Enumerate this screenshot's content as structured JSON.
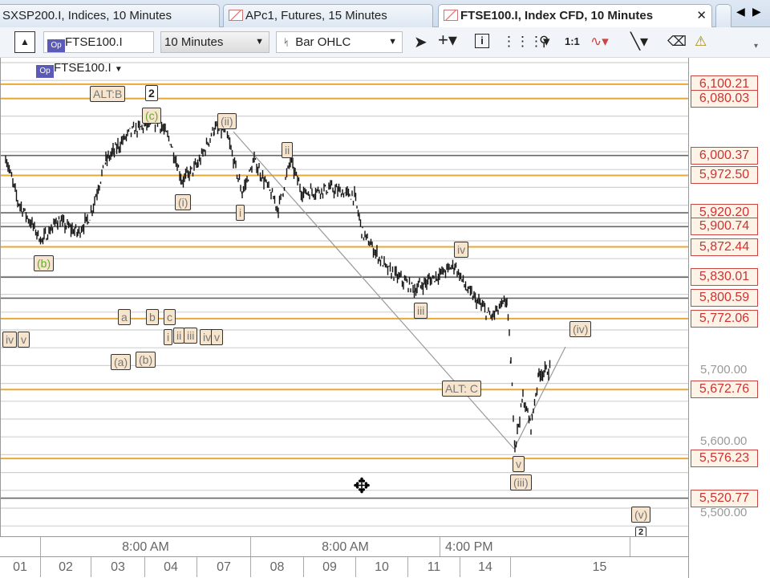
{
  "tabs": [
    {
      "label": "SXSP200.I, Indices, 10 Minutes"
    },
    {
      "label": "APc1, Futures, 15 Minutes"
    },
    {
      "label": "FTSE100.I, Index CFD, 10 Minutes",
      "active": true
    }
  ],
  "toolbar": {
    "symbol": "FTSE100.I",
    "interval": "10 Minutes",
    "chart_type": "Bar OHLC",
    "op_badge": "Op",
    "zoom_label": "1:1"
  },
  "legend": {
    "symbol": "FTSE100.I"
  },
  "colors": {
    "level_line": "#e8a838",
    "grey_line": "#666666",
    "level_box": "#cc4444"
  },
  "chart_data": {
    "type": "bar",
    "title": "FTSE100.I OHLC 10 Minutes",
    "ylim": [
      5470,
      6130
    ],
    "y_ticks": [
      "5,700.00",
      "5,600.00",
      "5,500.00"
    ],
    "price_levels": [
      "6,100.21",
      "6,080.03",
      "6,000.37",
      "5,972.50",
      "5,920.20",
      "5,900.74",
      "5,872.44",
      "5,830.01",
      "5,800.59",
      "5,772.06",
      "5,672.76",
      "5,576.23",
      "5,520.77"
    ],
    "x_sessions": [
      "8:00 AM",
      "8:00 AM",
      "4:00 PM"
    ],
    "x_days": [
      "01",
      "02",
      "03",
      "04",
      "07",
      "08",
      "09",
      "10",
      "11",
      "14",
      "15"
    ],
    "path": [
      [
        0,
        5999
      ],
      [
        15,
        5937
      ],
      [
        45,
        5881
      ],
      [
        65,
        5909
      ],
      [
        90,
        5892
      ],
      [
        105,
        5915
      ],
      [
        125,
        5993
      ],
      [
        155,
        6033
      ],
      [
        190,
        6049
      ],
      [
        205,
        6021
      ],
      [
        220,
        5965
      ],
      [
        240,
        5988
      ],
      [
        260,
        6038
      ],
      [
        275,
        6033
      ],
      [
        295,
        5948
      ],
      [
        310,
        5993
      ],
      [
        325,
        5960
      ],
      [
        340,
        5926
      ],
      [
        355,
        5993
      ],
      [
        370,
        5948
      ],
      [
        405,
        5954
      ],
      [
        435,
        5943
      ],
      [
        445,
        5892
      ],
      [
        475,
        5842
      ],
      [
        510,
        5813
      ],
      [
        535,
        5830
      ],
      [
        560,
        5847
      ],
      [
        575,
        5813
      ],
      [
        605,
        5774
      ],
      [
        625,
        5797
      ],
      [
        630,
        5707
      ],
      [
        635,
        5594
      ],
      [
        645,
        5662
      ],
      [
        655,
        5622
      ],
      [
        665,
        5696
      ],
      [
        680,
        5701
      ]
    ],
    "wave_labels": [
      "ALT:B",
      "2",
      "(c)",
      "(ii)",
      "ii",
      "(i)",
      "i",
      "(b)",
      "iv",
      "iii",
      "a",
      "b",
      "c",
      "i",
      "ii",
      "iii",
      "iv",
      "v",
      "iv",
      "v",
      "(a)",
      "(b)",
      "(iv)",
      "ALT: C",
      "v",
      "(iii)",
      "(v)",
      "2"
    ]
  }
}
